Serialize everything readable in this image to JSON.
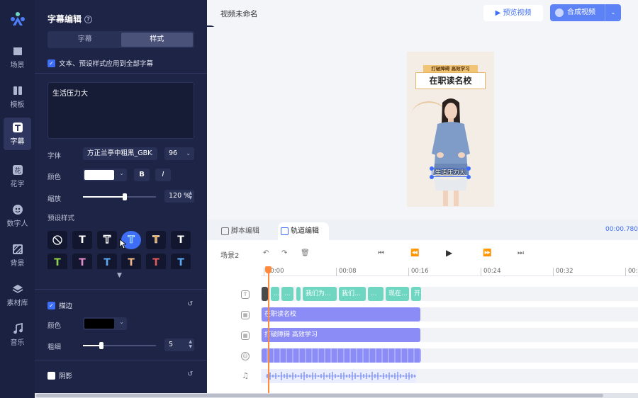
{
  "rail": {
    "items": [
      {
        "label": "场景",
        "icon": "clapperboard-icon"
      },
      {
        "label": "模板",
        "icon": "template-icon"
      },
      {
        "label": "字幕",
        "icon": "text-t-icon"
      },
      {
        "label": "花字",
        "icon": "fancy-text-icon"
      },
      {
        "label": "数字人",
        "icon": "digital-human-icon"
      },
      {
        "label": "背景",
        "icon": "background-icon"
      },
      {
        "label": "素材库",
        "icon": "layers-icon"
      },
      {
        "label": "音乐",
        "icon": "music-note-icon"
      }
    ],
    "active_index": 2
  },
  "panel": {
    "title": "字幕编辑",
    "help": "?",
    "tabs": [
      "字幕",
      "样式"
    ],
    "active_tab": "样式",
    "apply_all_label": "文本、预设样式应用到全部字幕",
    "text_value": "生活压力大",
    "font_label": "字体",
    "font_value": "方正兰亭中粗黑_GBK",
    "size_value": "96",
    "color_label": "颜色",
    "bold_label": "B",
    "italic_label": "I",
    "scale_label": "缩放",
    "scale_value": "120 %",
    "scale_fraction": 0.57,
    "preset_label": "预设样式",
    "preset_glyph": "T",
    "presets_row1_colors": [
      "#ffffff",
      "#ffffff",
      "#ffffff",
      "#f3a33a",
      "#ffffff"
    ],
    "presets_row2_colors": [
      "#8fd14f",
      "#e48acb",
      "#5aa9f0",
      "#f0b889",
      "#e85a5a",
      "#5aa9f0"
    ],
    "stroke_label": "描边",
    "stroke_color_label": "颜色",
    "stroke_color": "#000000",
    "thickness_label": "粗细",
    "thickness_value": "5",
    "thickness_fraction": 0.25,
    "shadow_label": "阴影"
  },
  "topbar": {
    "title": "视频未命名",
    "preview_label": "预览视频",
    "compose_label": "合成视频"
  },
  "video": {
    "banner_top": "打破障碍 高效学习",
    "banner_main": "在职读名校",
    "caption": "生活压力大"
  },
  "editor": {
    "tabs": [
      "脚本编辑",
      "轨道编辑"
    ],
    "active_tab": "轨道编辑",
    "timecode": "00:00.780",
    "scene_label": "场景2",
    "ruler": [
      "00:00",
      "00:08",
      "00:16",
      "00:24",
      "00:32",
      "00:4"
    ],
    "subtitle_clips": [
      "",
      "...",
      "...",
      "",
      "我们为...",
      "我们...",
      "...",
      "现在...",
      "开"
    ],
    "text_track_1": "在职读名校",
    "text_track_2": "打破障碍 高效学习"
  }
}
